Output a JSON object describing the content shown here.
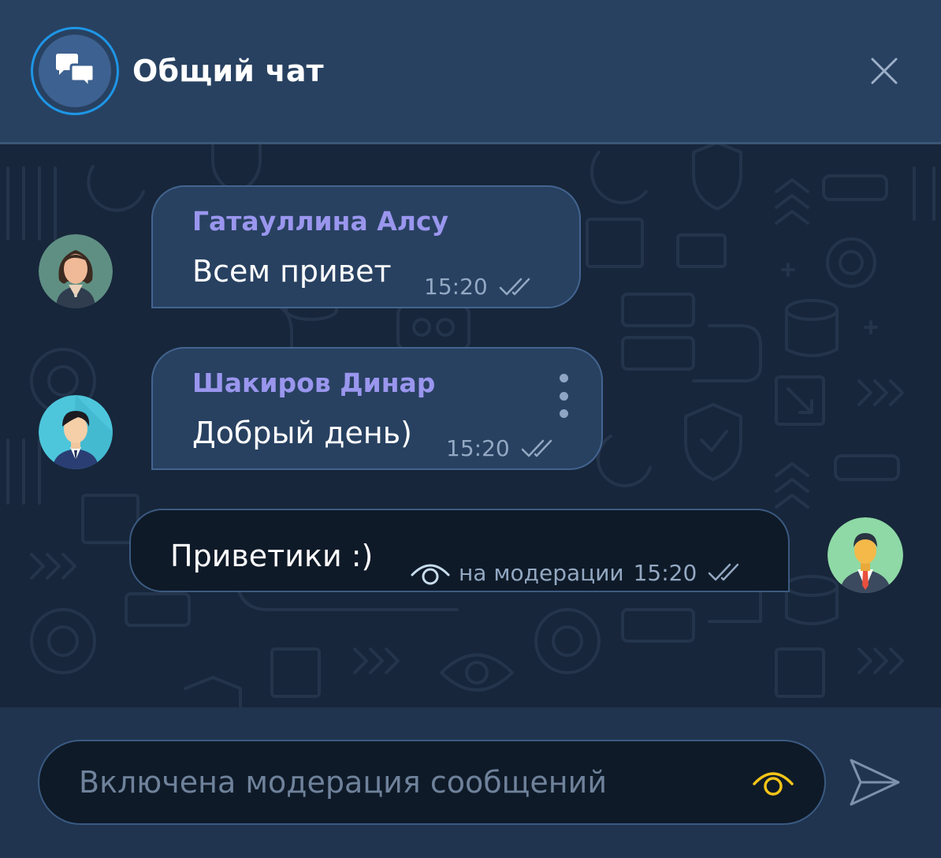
{
  "header": {
    "title": "Общий чат",
    "logo_icon": "chat-bubbles-icon",
    "close_icon": "close-icon"
  },
  "messages": [
    {
      "sender": "Гатауллина Алсу",
      "text": "Всем привет",
      "time": "15:20",
      "status_icon": "double-check-icon",
      "avatar": "female-avatar"
    },
    {
      "sender": "Шакиров Динар",
      "text": "Добрый день)",
      "time": "15:20",
      "status_icon": "double-check-icon",
      "avatar": "male-avatar",
      "menu_icon": "more-vertical-icon"
    },
    {
      "own": true,
      "text": "Приветики  :)",
      "moderation_status": "на модерации",
      "time": "15:20",
      "status_icon": "double-check-icon",
      "avatar": "user-avatar"
    }
  ],
  "composer": {
    "placeholder": "Включена модерация сообщений",
    "value": "",
    "moderation_icon": "eye-icon",
    "send_icon": "send-icon"
  },
  "colors": {
    "header_bg": "#284161",
    "chat_bg": "#17263a",
    "bubble_bg": "#284161",
    "own_bubble_bg": "#0f1a28",
    "sender_name": "#9a96ee",
    "accent_ring": "#1e96e6",
    "moderation_eye": "#f5c518"
  }
}
